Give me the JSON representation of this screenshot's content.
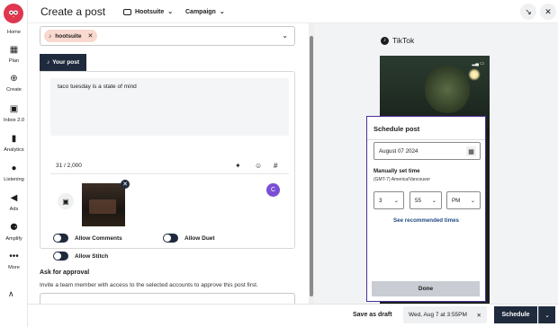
{
  "nav": {
    "items": [
      {
        "label": "Home",
        "icon": "home-icon",
        "glyph": "⌂"
      },
      {
        "label": "Plan",
        "icon": "calendar-icon",
        "glyph": "▦"
      },
      {
        "label": "Create",
        "icon": "plus-circle-icon",
        "glyph": "⊕"
      },
      {
        "label": "Inbox 2.0",
        "icon": "inbox-icon",
        "glyph": "▣"
      },
      {
        "label": "Analytics",
        "icon": "bar-chart-icon",
        "glyph": "▮"
      },
      {
        "label": "Listening",
        "icon": "lightbulb-icon",
        "glyph": "●"
      },
      {
        "label": "Ads",
        "icon": "megaphone-icon",
        "glyph": "◀"
      },
      {
        "label": "Amplify",
        "icon": "amplify-icon",
        "glyph": "⚈"
      },
      {
        "label": "More",
        "icon": "more-icon",
        "glyph": "•••"
      }
    ],
    "collapse_glyph": "∧"
  },
  "header": {
    "title": "Create a post",
    "org": "Hootsuite",
    "campaign": "Campaign",
    "minimize_glyph": "↘",
    "close_glyph": "✕"
  },
  "composer": {
    "account_chip": "hootsuite",
    "account_chip_remove": "✕",
    "tab_label": "Your post",
    "post_text": "taco tuesday is a state of mind",
    "char_count": "31 / 2,000",
    "avatar_letter": "C",
    "toggles": {
      "comments": "Allow Comments",
      "duet": "Allow Duet",
      "stitch": "Allow Stitch"
    },
    "approval_title": "Ask for approval",
    "approval_desc": "Invite a team member with access to the selected accounts to approve this post first."
  },
  "preview": {
    "network": "TikTok"
  },
  "schedule": {
    "title": "Schedule post",
    "date": "August 07 2024",
    "manual_label": "Manually set time",
    "timezone": "(GMT-7) America/Vancouver",
    "hour": "3",
    "minute": "55",
    "ampm": "PM",
    "recommended": "See recommended times",
    "done": "Done"
  },
  "footer": {
    "save_draft": "Save as draft",
    "scheduled_time": "Wed, Aug 7 at 3:55PM",
    "scheduled_clear": "✕",
    "schedule_btn": "Schedule",
    "more_glyph": "⌄"
  },
  "colors": {
    "brand_red": "#e0364f",
    "navy": "#1f2a3d",
    "popover_border": "#4b2f9a",
    "link_blue": "#1f4a84",
    "chip_peach": "#f9d8cf"
  }
}
